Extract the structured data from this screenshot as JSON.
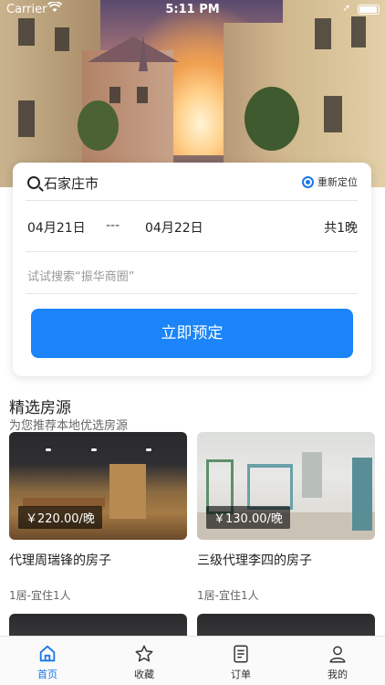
{
  "status_bar": {
    "carrier": "Carrier",
    "time": "5:11 PM"
  },
  "search": {
    "city": "石家庄市",
    "relocate_label": "重新定位",
    "check_in": "04月21日",
    "separator": "---",
    "check_out": "04月22日",
    "nights": "共1晚",
    "keyword_placeholder": "试试搜索“振华商圈”",
    "submit_label": "立即预定"
  },
  "section": {
    "title": "精选房源",
    "subtitle": "为您推荐本地优选房源"
  },
  "listings": [
    {
      "price": "￥220.00/晚",
      "name": "代理周瑞锋的房子",
      "meta": "1居-宜住1人"
    },
    {
      "price": "￥130.00/晚",
      "name": "三级代理李四的房子",
      "meta": "1居-宜住1人"
    }
  ],
  "tabbar": {
    "items": [
      {
        "label": "首页",
        "icon": "home-icon",
        "active": true
      },
      {
        "label": "收藏",
        "icon": "star-icon",
        "active": false
      },
      {
        "label": "订单",
        "icon": "document-icon",
        "active": false
      },
      {
        "label": "我的",
        "icon": "person-icon",
        "active": false
      }
    ]
  },
  "colors": {
    "accent": "#1a84f8",
    "active_tab": "#1a78e8"
  }
}
